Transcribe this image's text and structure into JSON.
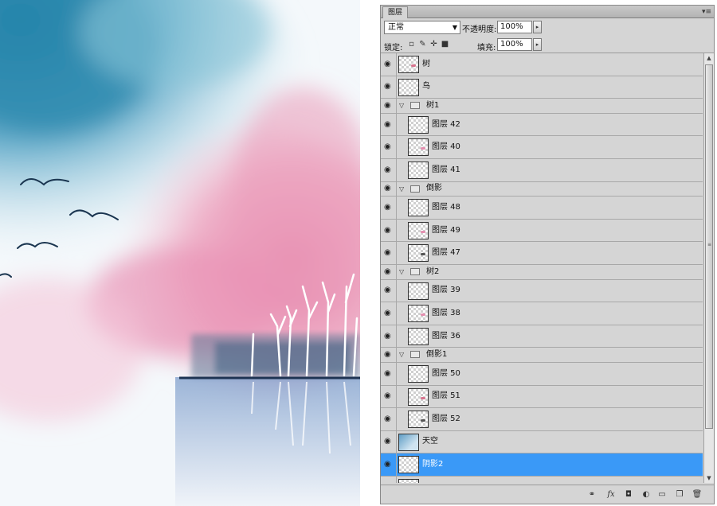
{
  "panel": {
    "tab_label": "图层",
    "menu_icon": "▾≡",
    "blend_mode": "正常",
    "opacity_label": "不透明度:",
    "opacity_value": "100%",
    "lock_label": "锁定:",
    "fill_label": "填充:",
    "fill_value": "100%"
  },
  "layers": [
    {
      "name": "树",
      "kind": "layer",
      "indent": 0,
      "mark": "#d9748f"
    },
    {
      "name": "鸟",
      "kind": "layer",
      "indent": 0,
      "mark": ""
    },
    {
      "name": "树1",
      "kind": "group"
    },
    {
      "name": "图层 42",
      "kind": "layer",
      "indent": 1,
      "mark": ""
    },
    {
      "name": "图层 40",
      "kind": "layer",
      "indent": 1,
      "mark": "#e58fb0"
    },
    {
      "name": "图层 41",
      "kind": "layer",
      "indent": 1,
      "mark": ""
    },
    {
      "name": "倒影",
      "kind": "group"
    },
    {
      "name": "图层 48",
      "kind": "layer",
      "indent": 1,
      "mark": ""
    },
    {
      "name": "图层 49",
      "kind": "layer",
      "indent": 1,
      "mark": "#e58fb0"
    },
    {
      "name": "图层 47",
      "kind": "layer",
      "indent": 1,
      "mark": "#555555"
    },
    {
      "name": "树2",
      "kind": "group"
    },
    {
      "name": "图层 39",
      "kind": "layer",
      "indent": 1,
      "mark": ""
    },
    {
      "name": "图层 38",
      "kind": "layer",
      "indent": 1,
      "mark": "#e58fb0"
    },
    {
      "name": "图层 36",
      "kind": "layer",
      "indent": 1,
      "mark": ""
    },
    {
      "name": "倒影1",
      "kind": "group"
    },
    {
      "name": "图层 50",
      "kind": "layer",
      "indent": 1,
      "mark": ""
    },
    {
      "name": "图层 51",
      "kind": "layer",
      "indent": 1,
      "mark": "#d9748f"
    },
    {
      "name": "图层 52",
      "kind": "layer",
      "indent": 1,
      "mark": "#555555"
    },
    {
      "name": "天空",
      "kind": "layer",
      "indent": 0,
      "thumb": "sky"
    },
    {
      "name": "阴影2",
      "kind": "layer",
      "indent": 0,
      "selected": true
    },
    {
      "name": "",
      "kind": "layer",
      "indent": 0
    }
  ],
  "colors": {
    "selection": "#3a99f7",
    "panel_bg": "#d5d5d5",
    "sky_teal": "#2a87ad",
    "blossom_pink": "#e792b3",
    "water_blue": "#9fb6d6"
  },
  "footer_icons": [
    "link-icon",
    "fx-icon",
    "mask-icon",
    "adjustment-icon",
    "new-group-icon",
    "new-layer-icon",
    "trash-icon"
  ]
}
